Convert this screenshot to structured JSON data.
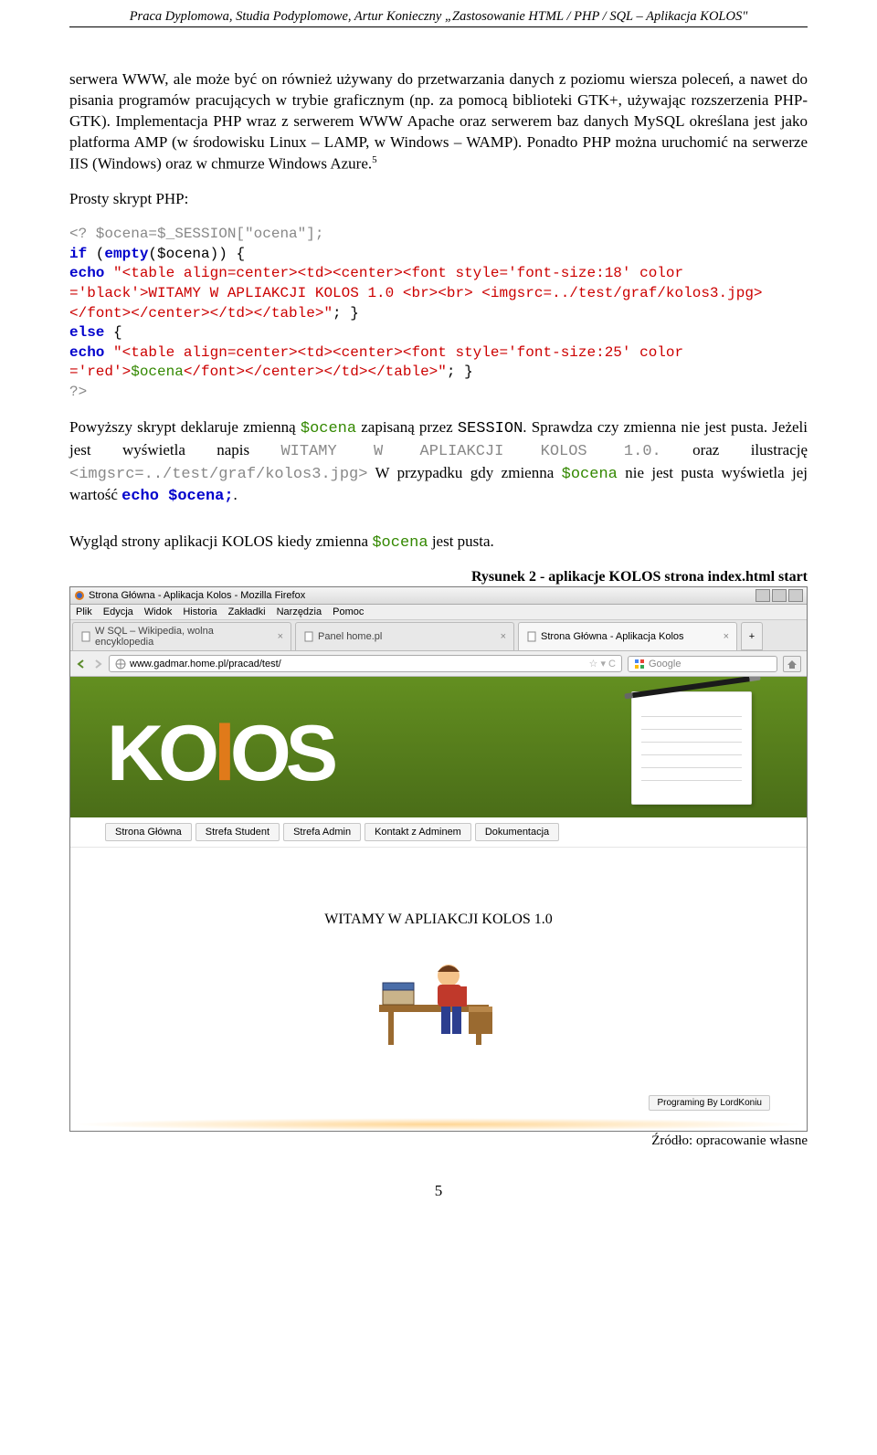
{
  "header": "Praca Dyplomowa, Studia Podyplomowe, Artur Konieczny „Zastosowanie HTML / PHP / SQL – Aplikacja KOLOS\"",
  "para1": "serwera WWW, ale może być on również używany do przetwarzania danych z poziomu wiersza poleceń, a nawet do pisania programów pracujących w trybie graficznym (np. za pomocą biblioteki GTK+, używając rozszerzenia PHP-GTK). Implementacja PHP wraz z serwerem WWW Apache oraz serwerem baz danych MySQL określana jest jako platforma AMP (w środowisku Linux – LAMP, w Windows – WAMP). Ponadto PHP można uruchomić na serwerze IIS (Windows) oraz w chmurze Windows Azure.",
  "sup5": "5",
  "label_prosty": "Prosty skrypt PHP:",
  "code": {
    "l1": "<? $ocena=$_SESSION[\"ocena\"];",
    "l2a": "if",
    "l2b": " (",
    "l2c": "empty",
    "l2d": "($ocena)) {",
    "l3a": "echo",
    "l3b": " \"<table align=center><td><center><font style='font-size:18' color ='black'>WITAMY W APLIAKCJI KOLOS 1.0 <br><br> <imgsrc=../test/graf/kolos3.jpg></font></center></td></table>\"",
    "l3c": "; }",
    "l4a": "else",
    "l4b": " {",
    "l5a": "echo",
    "l5b": " \"<table align=center><td><center><font style='font-size:25' color ='red'>",
    "l5c": "$ocena",
    "l5d": "</font></center></td></table>\"",
    "l5e": "; }",
    "l6": "?>"
  },
  "para2_a": "Powyższy skrypt deklaruje zmienną ",
  "para2_ocena": "$ocena",
  "para2_b": " zapisaną przez ",
  "para2_session": "SESSION",
  "para2_c": ". Sprawdza czy zmienna nie jest pusta. Jeżeli jest wyświetla napis ",
  "para2_witamy": "WITAMY W APLIAKCJI KOLOS 1.0.",
  "para2_d": " oraz ilustrację ",
  "para2_img": "<imgsrc=../test/graf/kolos3.jpg>",
  "para2_e": " W przypadku gdy zmienna ",
  "para2_f": " nie jest pusta wyświetla jej wartość ",
  "para2_echo": "echo $ocena;",
  "para2_g": ".",
  "para3_a": "Wygląd strony aplikacji KOLOS kiedy zmienna ",
  "para3_b": " jest pusta.",
  "fig_caption": "Rysunek 2 - aplikacje KOLOS strona index.html start",
  "source": "Źródło: opracowanie własne",
  "pagenum": "5",
  "browser": {
    "title": "Strona Główna - Aplikacja Kolos - Mozilla Firefox",
    "menu": [
      "Plik",
      "Edycja",
      "Widok",
      "Historia",
      "Zakładki",
      "Narzędzia",
      "Pomoc"
    ],
    "tab1": "W SQL – Wikipedia, wolna encyklopedia",
    "tab2": "Panel home.pl",
    "tab3": "Strona Główna - Aplikacja Kolos",
    "url": "www.gadmar.home.pl/pracad/test/",
    "search_placeholder": "Google",
    "nav": [
      "Strona Główna",
      "Strefa Student",
      "Strefa Admin",
      "Kontakt z Adminem",
      "Dokumentacja"
    ],
    "welcome": "WITAMY W APLIAKCJI KOLOS 1.0",
    "footer": "Programing By LordKoniu",
    "logo_a": "KO",
    "logo_b": "l",
    "logo_c": "OS"
  }
}
